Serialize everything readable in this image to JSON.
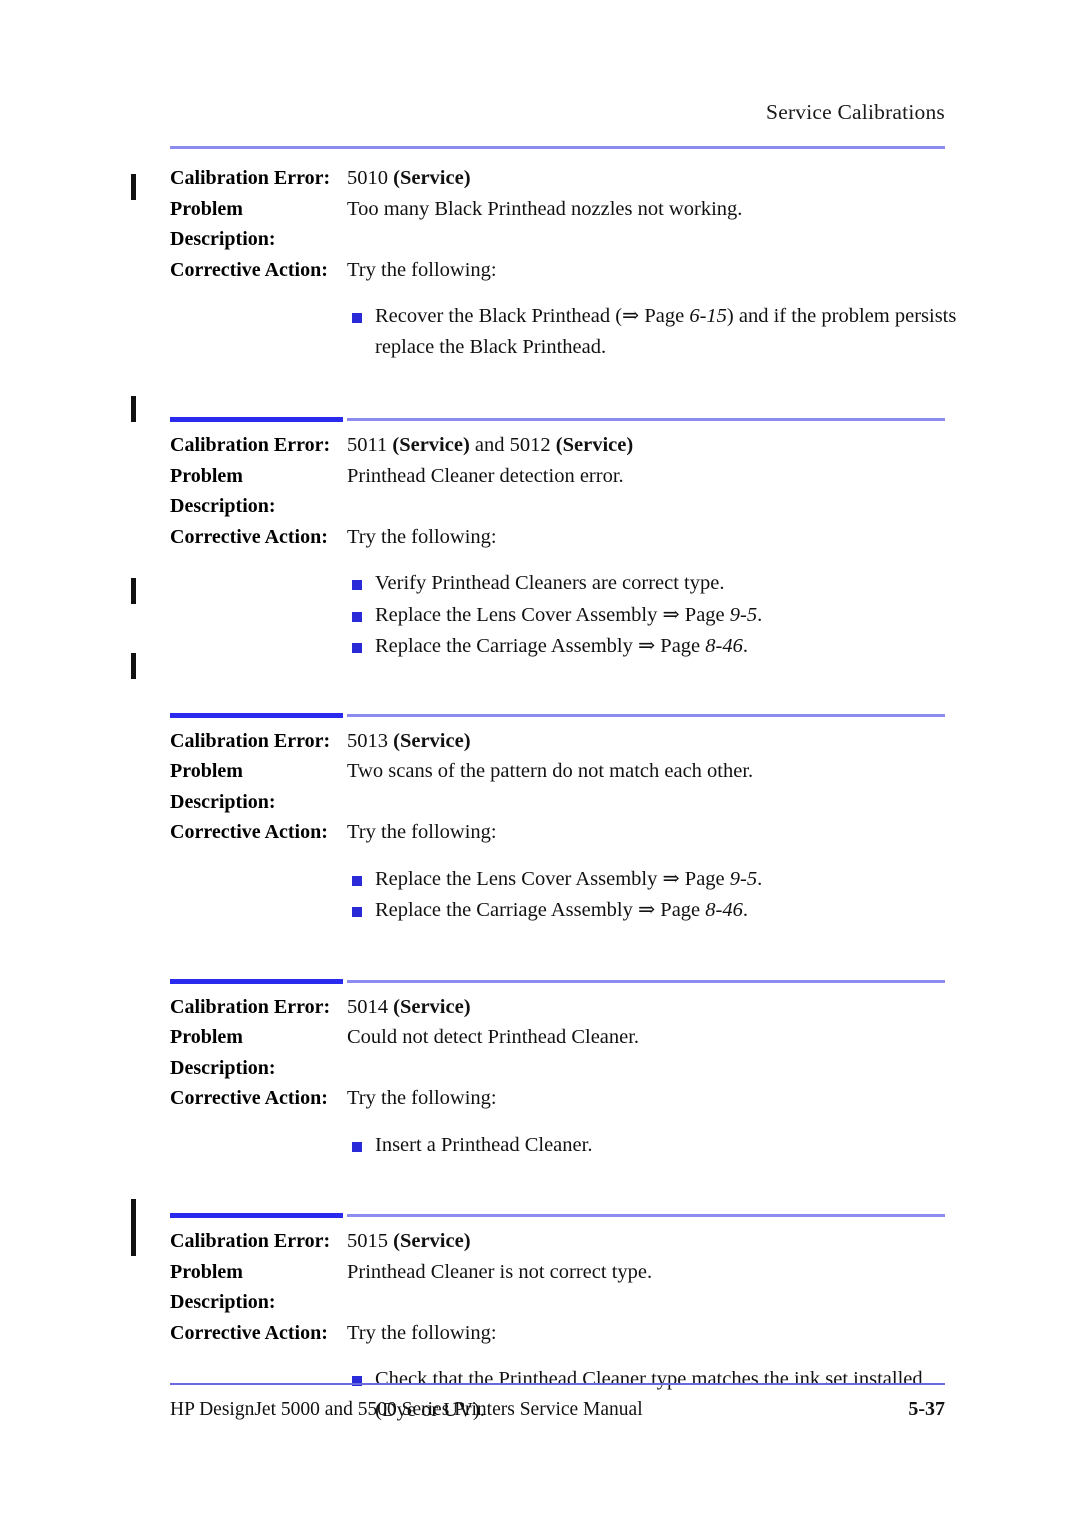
{
  "header": {
    "title": "Service Calibrations"
  },
  "labels": {
    "calibration_error": "Calibration Error:",
    "problem": "Problem",
    "description": "Description:",
    "corrective_action": "Corrective Action:"
  },
  "sections": [
    {
      "error_code": "5010",
      "error_tag": "(Service)",
      "error_suffix": "",
      "problem": "Too many Black Printhead nozzles not working.",
      "action_intro": "Try the following:",
      "bullets": [
        {
          "pre": "Recover the Black Printhead (⇒ Page ",
          "ref": "6-15",
          "post": ") and if the problem persists replace the Black Printhead."
        }
      ]
    },
    {
      "error_code": "5011",
      "error_tag": "(Service)",
      "error_suffix": " and 5012 (Service)",
      "problem": "Printhead Cleaner detection error.",
      "action_intro": "Try the following:",
      "bullets": [
        {
          "pre": "Verify Printhead Cleaners are correct type.",
          "ref": "",
          "post": ""
        },
        {
          "pre": "Replace the Lens Cover Assembly ⇒ Page ",
          "ref": "9-5",
          "post": "."
        },
        {
          "pre": "Replace the Carriage Assembly ⇒ Page ",
          "ref": "8-46",
          "post": "."
        }
      ]
    },
    {
      "error_code": "5013",
      "error_tag": "(Service)",
      "error_suffix": "",
      "problem": "Two scans of the pattern do not match each other.",
      "action_intro": "Try the following:",
      "bullets": [
        {
          "pre": "Replace the Lens Cover Assembly ⇒ Page ",
          "ref": "9-5",
          "post": "."
        },
        {
          "pre": "Replace the Carriage Assembly ⇒ Page ",
          "ref": "8-46",
          "post": "."
        }
      ]
    },
    {
      "error_code": "5014",
      "error_tag": "(Service)",
      "error_suffix": "",
      "problem": "Could not detect Printhead Cleaner.",
      "action_intro": "Try the following:",
      "bullets": [
        {
          "pre": "Insert a Printhead Cleaner.",
          "ref": "",
          "post": ""
        }
      ]
    },
    {
      "error_code": "5015",
      "error_tag": "(Service)",
      "error_suffix": "",
      "problem": "Printhead Cleaner is not correct type.",
      "action_intro": "Try the following:",
      "bullets": [
        {
          "pre": "Check that the Printhead Cleaner type matches the ink set installed (Dye or UV).",
          "ref": "",
          "post": ""
        }
      ]
    }
  ],
  "footer": {
    "manual_title": "HP DesignJet 5000 and 5500 Series Printers Service Manual",
    "page_number": "5-37"
  },
  "colors": {
    "rule_light": "#8b8bf0",
    "rule_dark": "#2a2aee",
    "bullet": "#2a2ad8",
    "change_bar": "#111111"
  }
}
